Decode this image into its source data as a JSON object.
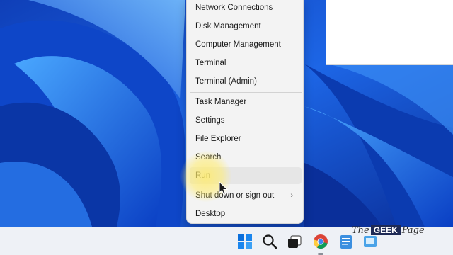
{
  "context_menu": {
    "items": [
      {
        "label": "Network Connections",
        "name": "menu-item-network-connections"
      },
      {
        "label": "Disk Management",
        "name": "menu-item-disk-management"
      },
      {
        "label": "Computer Management",
        "name": "menu-item-computer-management"
      },
      {
        "label": "Terminal",
        "name": "menu-item-terminal"
      },
      {
        "label": "Terminal (Admin)",
        "name": "menu-item-terminal-admin"
      },
      {
        "label": "Task Manager",
        "name": "menu-item-task-manager"
      },
      {
        "label": "Settings",
        "name": "menu-item-settings"
      },
      {
        "label": "File Explorer",
        "name": "menu-item-file-explorer"
      },
      {
        "label": "Search",
        "name": "menu-item-search"
      },
      {
        "label": "Run",
        "name": "menu-item-run",
        "state": "hovered"
      },
      {
        "label": "Shut down or sign out",
        "name": "menu-item-shut-down",
        "submenu": true
      },
      {
        "label": "Desktop",
        "name": "menu-item-desktop"
      }
    ],
    "submenu_glyph": "›"
  },
  "taskbar": {
    "icons": [
      "windows-start-icon",
      "search-icon",
      "task-view-icon",
      "chrome-icon",
      "notepad-icon",
      "app-icon"
    ]
  },
  "watermark": {
    "prefix": "The",
    "highlight": "GEEK",
    "suffix": "Page"
  },
  "colors": {
    "wallpaper": "#1b5fe0",
    "menu_bg": "#f3f3f3",
    "taskbar_bg": "#eef1f6",
    "highlight": "#ffec6e"
  }
}
